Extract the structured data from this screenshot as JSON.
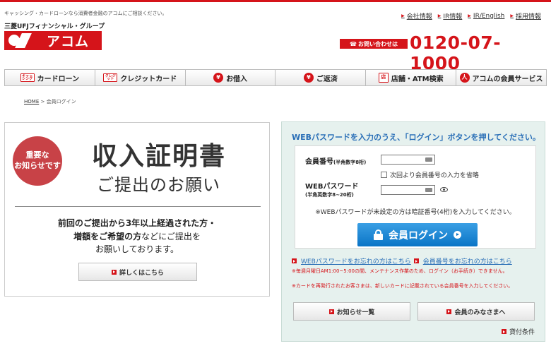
{
  "header": {
    "tagline": "キャッシング・カードローンなら消費者金融のアコムにご相談ください。",
    "group_name": "三菱UFJフィナンシャル・グループ",
    "logo_text": "アコム",
    "links": [
      {
        "label": "会社情報"
      },
      {
        "label": "IR情報"
      },
      {
        "label": "IR/English"
      },
      {
        "label": "採用情報"
      }
    ],
    "contact_label": "お問い合わせは",
    "phone": "0120-07-1000"
  },
  "nav": {
    "items": [
      {
        "label": "カードローン",
        "icon_text": "キャッシング"
      },
      {
        "label": "クレジットカード",
        "icon_text": "クレジット"
      },
      {
        "label": "お借入",
        "icon_text": "¥"
      },
      {
        "label": "ご返済",
        "icon_text": "¥"
      },
      {
        "label": "店舗・ATM検索",
        "icon_text": "店"
      },
      {
        "label": "アコムの会員サービス",
        "icon_text": "人"
      }
    ]
  },
  "breadcrumb": {
    "home": "HOME",
    "separator": ">",
    "current": "会員ログイン"
  },
  "notice": {
    "badge_line1": "重要な",
    "badge_line2": "お知らせです",
    "title": "収入証明書",
    "subtitle": "ご提出のお願い",
    "body_line1": "前回のご提出から3年以上経過された方・",
    "body_line2_bold": "増額をご希望の方",
    "body_line2_rest": "などにご提出を",
    "body_line3": "お願いしております。",
    "detail_button": "詳しくはこちら"
  },
  "login": {
    "heading": "WEBパスワードを入力のうえ、「ログイン」ボタンを押してください。",
    "member_label": "会員番号",
    "member_hint": "(半角数字8桁)",
    "remember_label": "次回より会員番号の入力を省略",
    "password_label": "WEBパスワード",
    "password_hint": "(半角英数字8~20桁)",
    "note": "※WEBパスワードが未設定の方は暗証番号(4桁)を入力してください。",
    "login_button": "会員ログイン",
    "forgot_password": "WEBパスワードをお忘れの方はこちら",
    "forgot_member": "会員番号をお忘れの方はこちら",
    "warning1": "※毎週月曜日AM1:00~5:00の間、メンテナンス作業のため、ログイン（お手続き）できません。",
    "warning2": "※カードを再発行されたお客さまは、新しいカードに記載されている会員番号を入力してください。",
    "news_button": "お知らせ一覧",
    "members_button": "会員のみなさまへ",
    "loan_terms": "貸付条件"
  }
}
